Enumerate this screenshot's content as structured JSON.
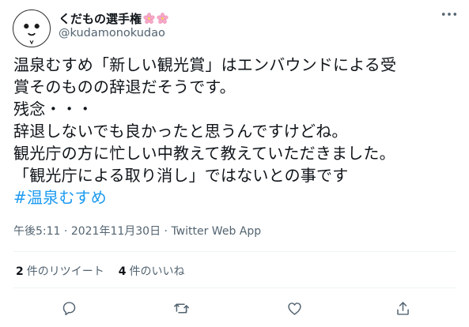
{
  "user": {
    "display_name": "くだもの選手権",
    "handle": "@kudamonokudao",
    "badges": [
      "cherry-blossom-icon",
      "cherry-blossom-icon"
    ]
  },
  "tweet": {
    "lines": [
      "温泉むすめ「新しい観光賞」はエンバウンドによる受",
      "賞そのものの辞退だそうです。",
      "残念・・・",
      "辞退しないでも良かったと思うんですけどね。",
      "観光庁の方に忙しい中教えて教えていただきました。",
      "「観光庁による取り消し」ではないとの事です"
    ],
    "hashtag": "#温泉むすめ"
  },
  "meta": {
    "time": "午後5:11",
    "separator": " · ",
    "date": "2021年11月30日",
    "source": "Twitter Web App"
  },
  "stats": {
    "retweets": {
      "count": "2",
      "label": "件のリツイート"
    },
    "likes": {
      "count": "4",
      "label": "件のいいね"
    }
  },
  "colors": {
    "text": "#0f1419",
    "secondary": "#536471",
    "link": "#1d9bf0",
    "divider": "#eff3f4"
  },
  "icons": {
    "more": "more-horizontal-icon",
    "reply": "reply-icon",
    "retweet": "retweet-icon",
    "like": "heart-icon",
    "share": "share-icon"
  }
}
